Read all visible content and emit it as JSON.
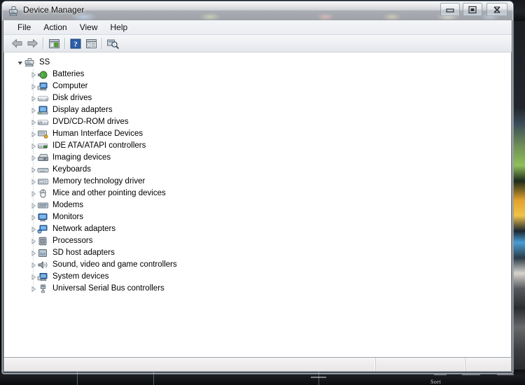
{
  "window": {
    "title": "Device Manager",
    "title_icon": "device-manager-icon",
    "controls": {
      "minimize_label": "Minimize",
      "maximize_label": "Maximize",
      "close_label": "Close"
    }
  },
  "menubar": {
    "items": [
      {
        "label": "File",
        "name": "menu-file"
      },
      {
        "label": "Action",
        "name": "menu-action"
      },
      {
        "label": "View",
        "name": "menu-view"
      },
      {
        "label": "Help",
        "name": "menu-help"
      }
    ]
  },
  "toolbar": {
    "buttons": [
      {
        "name": "back-button",
        "icon": "back-arrow-icon"
      },
      {
        "name": "forward-button",
        "icon": "forward-arrow-icon"
      },
      {
        "name": "properties-button",
        "icon": "properties-icon"
      },
      {
        "name": "help-button",
        "icon": "help-question-icon"
      },
      {
        "name": "show-hide-console-tree-button",
        "icon": "console-tree-icon"
      },
      {
        "name": "scan-hardware-changes-button",
        "icon": "scan-hardware-icon"
      }
    ]
  },
  "tree": {
    "root": {
      "label": "SS",
      "icon": "computer-icon",
      "expanded": true
    },
    "nodes": [
      {
        "label": "Batteries",
        "icon": "battery-icon"
      },
      {
        "label": "Computer",
        "icon": "computer-device-icon"
      },
      {
        "label": "Disk drives",
        "icon": "disk-drive-icon"
      },
      {
        "label": "Display adapters",
        "icon": "display-adapter-icon"
      },
      {
        "label": "DVD/CD-ROM drives",
        "icon": "dvd-drive-icon"
      },
      {
        "label": "Human Interface Devices",
        "icon": "hid-icon"
      },
      {
        "label": "IDE ATA/ATAPI controllers",
        "icon": "ide-controller-icon"
      },
      {
        "label": "Imaging devices",
        "icon": "imaging-device-icon"
      },
      {
        "label": "Keyboards",
        "icon": "keyboard-icon"
      },
      {
        "label": "Memory technology driver",
        "icon": "memory-driver-icon"
      },
      {
        "label": "Mice and other pointing devices",
        "icon": "mouse-icon"
      },
      {
        "label": "Modems",
        "icon": "modem-icon"
      },
      {
        "label": "Monitors",
        "icon": "monitor-icon"
      },
      {
        "label": "Network adapters",
        "icon": "network-adapter-icon"
      },
      {
        "label": "Processors",
        "icon": "processor-icon"
      },
      {
        "label": "SD host adapters",
        "icon": "sd-host-adapter-icon"
      },
      {
        "label": "Sound, video and game controllers",
        "icon": "sound-controller-icon"
      },
      {
        "label": "System devices",
        "icon": "system-device-icon"
      },
      {
        "label": "Universal Serial Bus controllers",
        "icon": "usb-controller-icon"
      }
    ]
  },
  "statusbar": {
    "main_text": "",
    "cell2_text": "",
    "cell3_text": ""
  },
  "desktop": {
    "taskbar_text": "Sort"
  },
  "colors": {
    "content_background": "#ffffff",
    "statusbar_background": "#efeded",
    "window_border": "#7887963",
    "help_icon_blue": "#2d5fa8",
    "battery_green": "#3f9a33"
  }
}
